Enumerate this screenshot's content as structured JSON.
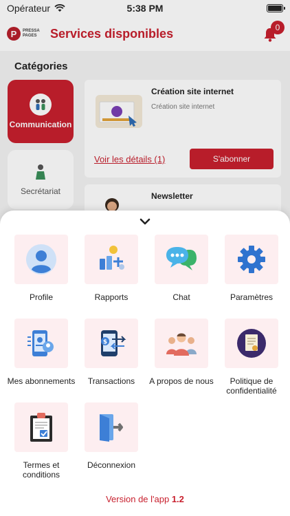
{
  "status": {
    "carrier": "Opérateur",
    "time": "5:38 PM"
  },
  "header": {
    "logo_letter": "P",
    "logo_text": "PRESSA PAGES",
    "title": "Services disponibles",
    "notif_count": "0"
  },
  "categories": {
    "title": "Catégories",
    "items": [
      {
        "label": "Communication",
        "active": true
      },
      {
        "label": "Secrétariat",
        "active": false
      }
    ]
  },
  "services": [
    {
      "title": "Création site internet",
      "subtitle": "Création site internet",
      "details_link": "Voir les détails (1)",
      "subscribe": "S'abonner"
    },
    {
      "title": "Newsletter"
    }
  ],
  "menu": {
    "items": [
      {
        "label": "Profile",
        "icon": "user-icon"
      },
      {
        "label": "Rapports",
        "icon": "reports-icon"
      },
      {
        "label": "Chat",
        "icon": "chat-icon"
      },
      {
        "label": "Paramètres",
        "icon": "gear-icon"
      },
      {
        "label": "Mes abonnements",
        "icon": "subscriptions-icon"
      },
      {
        "label": "Transactions",
        "icon": "transactions-icon"
      },
      {
        "label": "A propos de nous",
        "icon": "team-icon"
      },
      {
        "label": "Politique de confidentialité",
        "icon": "policy-icon"
      },
      {
        "label": "Termes et conditions",
        "icon": "terms-icon"
      },
      {
        "label": "Déconnexion",
        "icon": "logout-icon"
      }
    ]
  },
  "footer": {
    "version_prefix": "Version de l'app",
    "version_number": "1.2"
  },
  "colors": {
    "brand": "#c8202e",
    "tile_bg": "#fdeef0"
  }
}
